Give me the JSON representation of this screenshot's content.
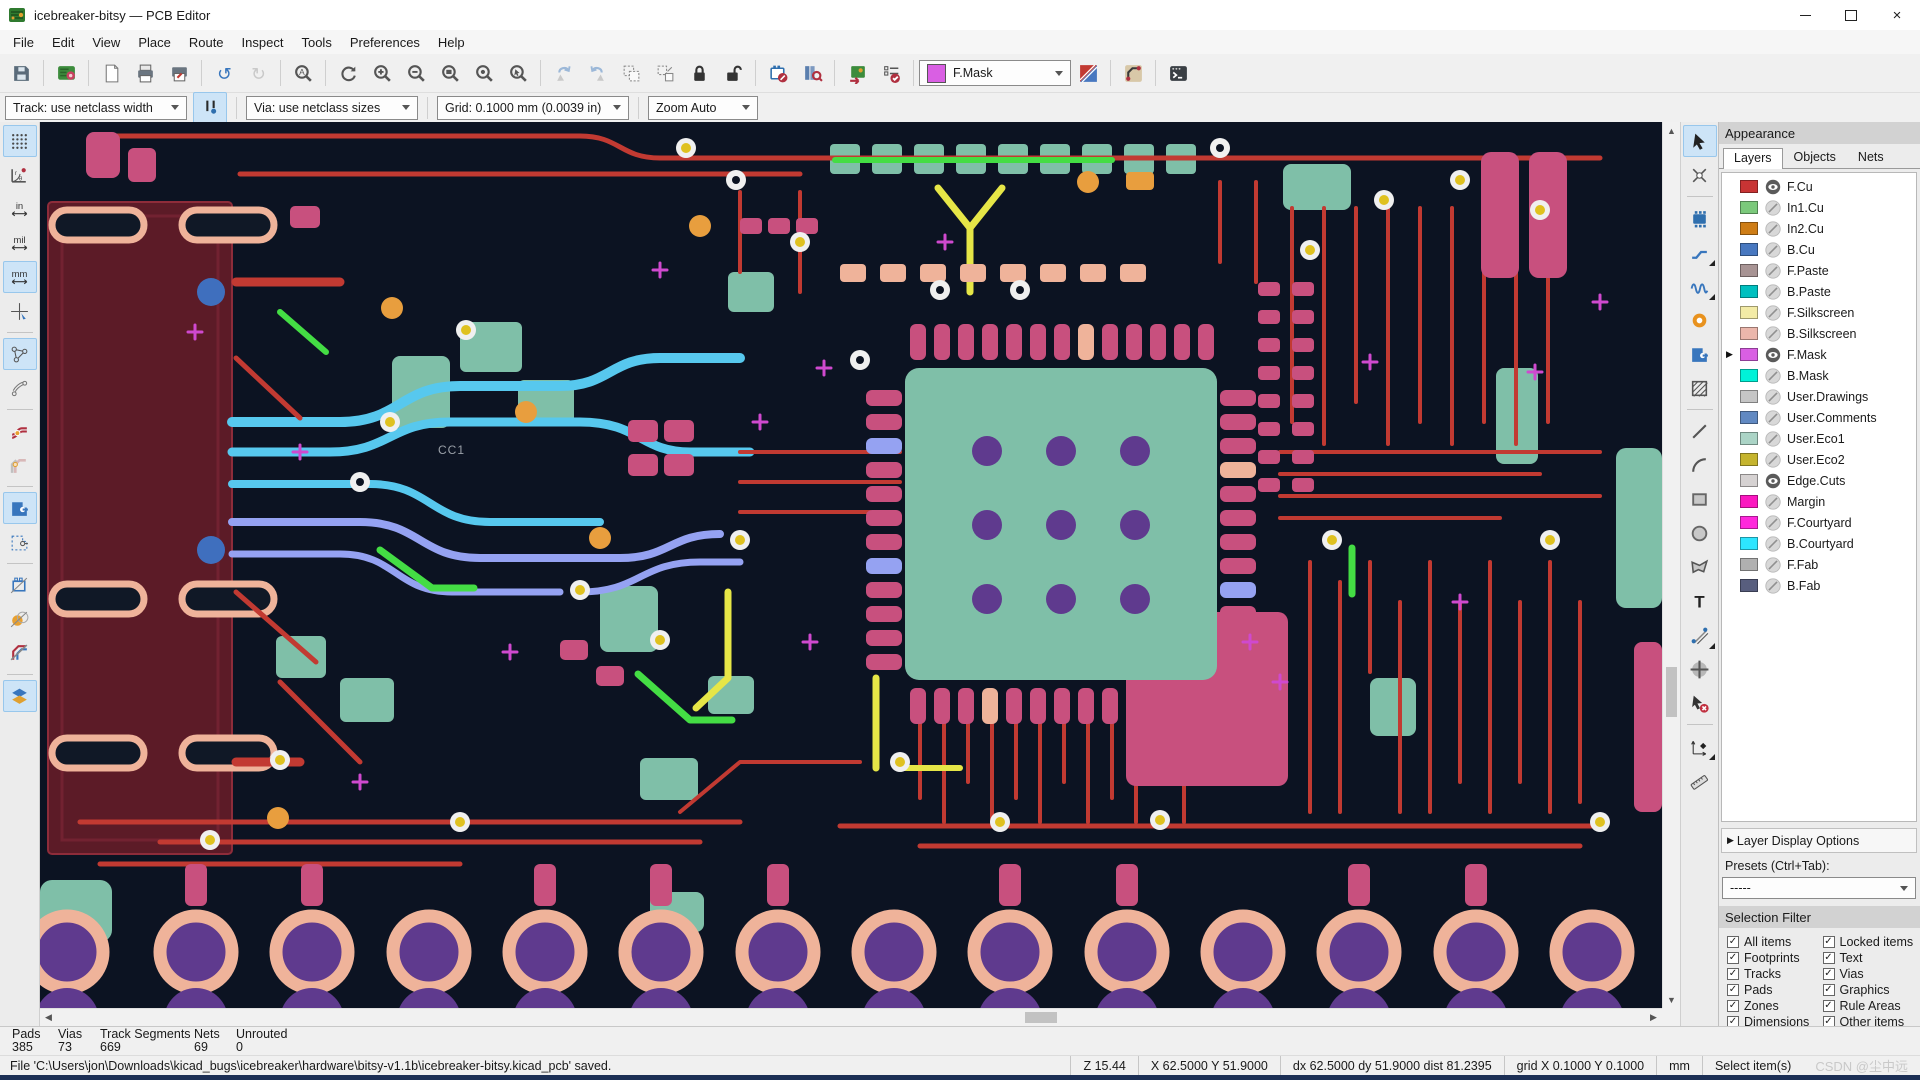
{
  "window": {
    "title": "icebreaker-bitsy — PCB Editor",
    "controls": [
      "minimize",
      "maximize",
      "close"
    ]
  },
  "menu": {
    "items": [
      "File",
      "Edit",
      "View",
      "Place",
      "Route",
      "Inspect",
      "Tools",
      "Preferences",
      "Help"
    ]
  },
  "toolbar": {
    "layer_selector": {
      "value": "F.Mask",
      "swatch": "#d95fe3"
    },
    "items": [
      {
        "icon": "save",
        "name": "save"
      },
      "|",
      {
        "icon": "board-setup",
        "name": "board-setup"
      },
      "|",
      {
        "icon": "page-setup",
        "name": "page-settings"
      },
      {
        "icon": "print",
        "name": "print"
      },
      {
        "icon": "plot",
        "name": "plot"
      },
      "|",
      {
        "icon": "undo",
        "name": "undo"
      },
      {
        "icon": "redo",
        "name": "redo",
        "disabled": true
      },
      "|",
      {
        "icon": "find",
        "name": "find"
      },
      "|",
      {
        "icon": "refresh",
        "name": "refresh-view"
      },
      {
        "icon": "zoom-in",
        "name": "zoom-in"
      },
      {
        "icon": "zoom-out",
        "name": "zoom-out"
      },
      {
        "icon": "zoom-fit",
        "name": "zoom-to-fit"
      },
      {
        "icon": "zoom-objects",
        "name": "zoom-to-objects"
      },
      {
        "icon": "zoom-selection",
        "name": "zoom-to-selection"
      },
      "|",
      {
        "icon": "rotate-ccw",
        "name": "rotate-ccw",
        "disabled": true
      },
      {
        "icon": "rotate-cw",
        "name": "rotate-cw",
        "disabled": true
      },
      {
        "icon": "group",
        "name": "group-items"
      },
      {
        "icon": "ungroup",
        "name": "ungroup-items"
      },
      {
        "icon": "lock",
        "name": "lock-items"
      },
      {
        "icon": "unlock",
        "name": "unlock-items"
      },
      "|",
      {
        "icon": "edit-footprints",
        "name": "edit-footprints"
      },
      {
        "icon": "footprint-browser",
        "name": "footprint-browser"
      },
      "|",
      {
        "icon": "update-pcb",
        "name": "update-pcb-from-schematic"
      },
      {
        "icon": "drc",
        "name": "run-drc"
      },
      "|",
      {
        "combo": true
      },
      {
        "icon": "layer-presentation",
        "name": "layer-presentation"
      },
      "|",
      {
        "icon": "router-settings",
        "name": "interactive-router-settings"
      },
      "|",
      {
        "icon": "console",
        "name": "scripting-console"
      }
    ]
  },
  "toolbar2": {
    "track": "Track: use netclass width",
    "auto_width_toggle": "auto-track-width-toggle",
    "via": "Via: use netclass sizes",
    "grid": "Grid: 0.1000 mm (0.0039 in)",
    "zoom": "Zoom Auto"
  },
  "left_toolbar": {
    "items": [
      {
        "icon": "grid",
        "name": "grid-visibility",
        "active": true
      },
      {
        "icon": "polar",
        "name": "polar-coordinates"
      },
      {
        "icon": "unit-in",
        "name": "units-inches"
      },
      {
        "icon": "unit-mil",
        "name": "units-mils"
      },
      {
        "icon": "unit-mm",
        "name": "units-mm",
        "active": true
      },
      {
        "icon": "crosshair",
        "name": "crosshair-cursor"
      },
      "|",
      {
        "icon": "ratsnest",
        "name": "show-ratsnest",
        "active": true
      },
      {
        "icon": "curved",
        "name": "curved-ratsnest"
      },
      "|",
      {
        "icon": "highlight-net",
        "name": "highlight-nets"
      },
      {
        "icon": "pale-tracks",
        "name": "net-color-mode"
      },
      "|",
      {
        "icon": "zone-fill",
        "name": "zone-fill-mode",
        "active": true
      },
      {
        "icon": "zone-outline",
        "name": "zone-outline-mode"
      },
      "|",
      {
        "icon": "sketch-fp",
        "name": "sketch-footprints"
      },
      {
        "icon": "sketch-pads",
        "name": "sketch-pads"
      },
      {
        "icon": "sketch-tracks",
        "name": "sketch-tracks"
      },
      "|",
      {
        "icon": "appearance",
        "name": "appearance-manager",
        "active": true
      }
    ]
  },
  "right_toolbar": {
    "items": [
      {
        "icon": "select",
        "name": "select-tool",
        "active": true
      },
      {
        "icon": "local-ratsnest",
        "name": "local-ratsnest"
      },
      "|",
      {
        "icon": "place-fp",
        "name": "place-footprint"
      },
      {
        "icon": "route",
        "name": "route-tracks",
        "sub": true
      },
      {
        "icon": "tune",
        "name": "tune-track-length",
        "sub": true
      },
      {
        "icon": "via",
        "name": "place-via"
      },
      {
        "icon": "zone-fill",
        "name": "add-filled-zone"
      },
      {
        "icon": "rule-area",
        "name": "add-rule-area"
      },
      "|",
      {
        "icon": "line",
        "name": "draw-line"
      },
      {
        "icon": "arc",
        "name": "draw-arc"
      },
      {
        "icon": "rect",
        "name": "draw-rectangle"
      },
      {
        "icon": "circle",
        "name": "draw-circle"
      },
      {
        "icon": "polygon",
        "name": "draw-polygon"
      },
      {
        "icon": "text",
        "name": "add-text"
      },
      {
        "icon": "dimension",
        "name": "add-dimension",
        "sub": true
      },
      {
        "icon": "target",
        "name": "alignment-target"
      },
      {
        "icon": "delete",
        "name": "delete-tool"
      },
      "|",
      {
        "icon": "origin",
        "name": "grid-origin",
        "sub": true
      },
      {
        "icon": "measure",
        "name": "measure-tool"
      }
    ]
  },
  "appearance": {
    "title": "Appearance",
    "tabs": [
      "Layers",
      "Objects",
      "Nets"
    ],
    "active_tab": "Layers",
    "layers": [
      {
        "name": "F.Cu",
        "color": "#c83434",
        "visible": true,
        "active": false
      },
      {
        "name": "In1.Cu",
        "color": "#7bc97b",
        "visible": false,
        "active": false
      },
      {
        "name": "In2.Cu",
        "color": "#ce7d16",
        "visible": false,
        "active": false
      },
      {
        "name": "B.Cu",
        "color": "#4878c0",
        "visible": false,
        "active": false
      },
      {
        "name": "F.Paste",
        "color": "#a89494",
        "visible": false,
        "active": false
      },
      {
        "name": "B.Paste",
        "color": "#00c0c0",
        "visible": false,
        "active": false
      },
      {
        "name": "F.Silkscreen",
        "color": "#f3eba6",
        "visible": false,
        "active": false
      },
      {
        "name": "B.Silkscreen",
        "color": "#ebb6ab",
        "visible": false,
        "active": false
      },
      {
        "name": "F.Mask",
        "color": "#d95fe3",
        "visible": true,
        "active": true
      },
      {
        "name": "B.Mask",
        "color": "#00f2d8",
        "visible": false,
        "active": false
      },
      {
        "name": "User.Drawings",
        "color": "#c5c5c5",
        "visible": false,
        "active": false
      },
      {
        "name": "User.Comments",
        "color": "#6189c2",
        "visible": false,
        "active": false
      },
      {
        "name": "User.Eco1",
        "color": "#abd4c6",
        "visible": false,
        "active": false
      },
      {
        "name": "User.Eco2",
        "color": "#c5b42e",
        "visible": false,
        "active": false
      },
      {
        "name": "Edge.Cuts",
        "color": "#d6d2d2",
        "visible": true,
        "active": false
      },
      {
        "name": "Margin",
        "color": "#fb18c0",
        "visible": false,
        "active": false
      },
      {
        "name": "F.Courtyard",
        "color": "#ff28dc",
        "visible": false,
        "active": false
      },
      {
        "name": "B.Courtyard",
        "color": "#2de5ff",
        "visible": false,
        "active": false
      },
      {
        "name": "F.Fab",
        "color": "#b0b0b0",
        "visible": false,
        "active": false
      },
      {
        "name": "B.Fab",
        "color": "#585e7e",
        "visible": false,
        "active": false
      }
    ],
    "layer_display_options": "Layer Display Options",
    "presets_label": "Presets (Ctrl+Tab):",
    "presets_value": "-----"
  },
  "selection_filter": {
    "title": "Selection Filter",
    "items": [
      {
        "label": "All items",
        "checked": true
      },
      {
        "label": "Locked items",
        "checked": true
      },
      {
        "label": "Footprints",
        "checked": true
      },
      {
        "label": "Text",
        "checked": true
      },
      {
        "label": "Tracks",
        "checked": true
      },
      {
        "label": "Vias",
        "checked": true
      },
      {
        "label": "Pads",
        "checked": true
      },
      {
        "label": "Graphics",
        "checked": true
      },
      {
        "label": "Zones",
        "checked": true
      },
      {
        "label": "Rule Areas",
        "checked": true
      },
      {
        "label": "Dimensions",
        "checked": true
      },
      {
        "label": "Other items",
        "checked": true
      }
    ]
  },
  "status": {
    "fields": [
      {
        "label": "Pads",
        "value": "385"
      },
      {
        "label": "Vias",
        "value": "73"
      },
      {
        "label": "Track Segments",
        "value": "669"
      },
      {
        "label": "Nets",
        "value": "69"
      },
      {
        "label": "Unrouted",
        "value": "0"
      }
    ],
    "message": "File 'C:\\Users\\jon\\Downloads\\kicad_bugs\\icebreaker\\hardware\\bitsy-v1.1b\\icebreaker-bitsy.kicad_pcb' saved.",
    "zoom": "Z 15.44",
    "cursor": "X 62.5000  Y 51.9000",
    "delta": "dx 62.5000  dy 51.9000  dist 81.2395",
    "grid": "grid X 0.1000  Y 0.1000",
    "units": "mm",
    "hint": "Select item(s)",
    "watermark": "CSDN @尘中远"
  },
  "canvas": {
    "cc1_label": "CC1",
    "colors": {
      "background": "#0c1322",
      "pad_pink": "#c8507e",
      "mask_teal": "#7fbfa8",
      "drill_purple": "#5f3a8e",
      "salmon": "#efb39a",
      "trace_red": "#c23a32",
      "trace_cyan": "#57c8ee",
      "trace_periwinkle": "#95a2f2",
      "trace_yellow": "#e6e647",
      "trace_green": "#44dd44",
      "orange": "#e89e3e",
      "via_gold": "#dfc11f",
      "zone_dark_red": "#5c1b27",
      "white": "#f0f0f0",
      "plus_magenta": "#cf49cf",
      "blue_dot": "#3f6fbe"
    }
  }
}
